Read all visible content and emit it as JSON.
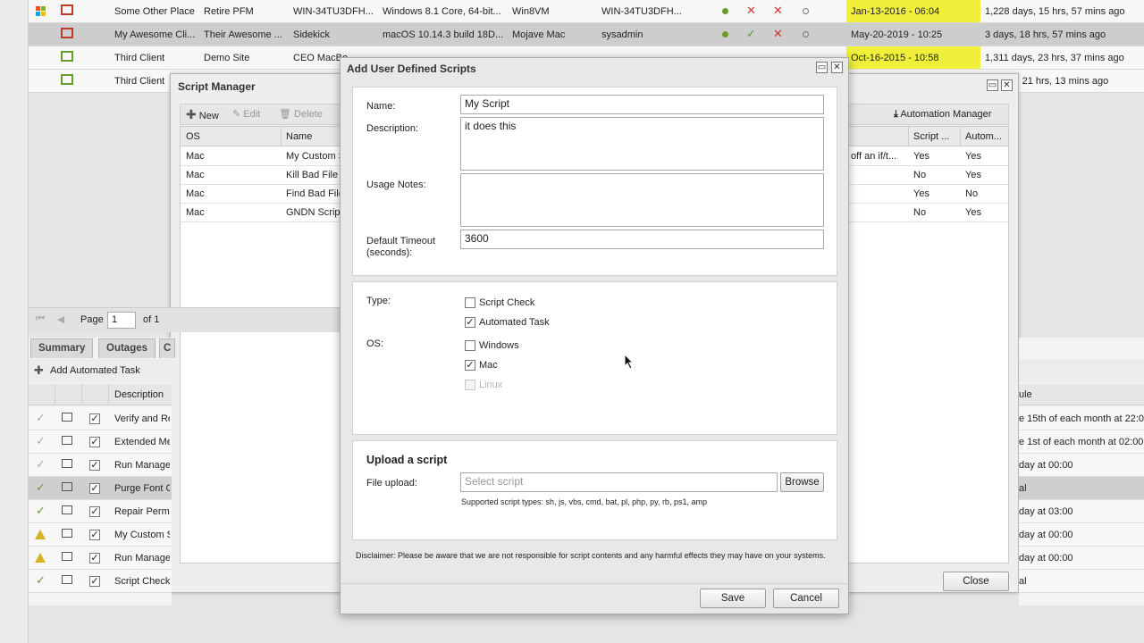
{
  "device_grid": {
    "rows": [
      {
        "os_icon": "windows-logo-icon",
        "client": "Some Other Place",
        "site": "Retire PFM",
        "name": "WIN-34TU3DFH...",
        "os": "Windows 8.1 Core, 64-bit...",
        "vm": "Win8VM",
        "user": "WIN-34TU3DFH...",
        "last_seen": "Jan-13-2016 - 06:04",
        "uptime": "1,228 days, 15 hrs, 57 mins ago",
        "highlight": true
      },
      {
        "os_icon": "apple-logo-icon",
        "client": "My Awesome Cli...",
        "site": "Their Awesome ...",
        "name": "Sidekick",
        "os": "macOS 10.14.3 build 18D...",
        "vm": "Mojave Mac",
        "user": "sysadmin",
        "last_seen": "May-20-2019 - 10:25",
        "uptime": "3 days, 18 hrs, 57 mins ago",
        "highlight": false
      },
      {
        "os_icon": "apple-logo-icon",
        "client": "Third Client",
        "site": "Demo Site",
        "name": "CEO MacBo",
        "os": "",
        "vm": "",
        "user": "",
        "last_seen": "Oct-16-2015 - 10:58",
        "uptime": "1,311 days, 23 hrs, 37 mins ago",
        "highlight": true
      },
      {
        "os_icon": "apple-logo-icon",
        "client": "Third Client",
        "site": "",
        "name": "",
        "os": "",
        "vm": "",
        "user": "",
        "last_seen": "",
        "uptime": "s, 21 hrs, 13 mins ago",
        "highlight": false
      }
    ]
  },
  "script_manager": {
    "title": "Script Manager",
    "toolbar": {
      "new": "New",
      "edit": "Edit",
      "delete": "Delete",
      "automation_manager": "Automation Manager"
    },
    "columns": {
      "os": "OS",
      "name": "Name",
      "script_check": "Script ...",
      "automated": "Autom..."
    },
    "rows": [
      {
        "os": "Mac",
        "name": "My Custom S",
        "desc": "off an if/t...",
        "script_check": "Yes",
        "automated": "Yes"
      },
      {
        "os": "Mac",
        "name": "Kill Bad File",
        "desc": "",
        "script_check": "No",
        "automated": "Yes"
      },
      {
        "os": "Mac",
        "name": "Find Bad File",
        "desc": "",
        "script_check": "Yes",
        "automated": "No"
      },
      {
        "os": "Mac",
        "name": "GNDN Script",
        "desc": "",
        "script_check": "No",
        "automated": "Yes"
      }
    ],
    "pager": {
      "page_label": "Page",
      "page_value": "1",
      "of_label": "of 1"
    },
    "close": "Close"
  },
  "bottom_panel": {
    "tabs": [
      "Summary",
      "Outages",
      "C"
    ],
    "add_task": "Add Automated Task",
    "add_task_more": "Aut",
    "columns": {
      "description": "Description",
      "schedule": "ule"
    },
    "rows": [
      {
        "status": "done",
        "description": "Verify and Re",
        "schedule": "e 15th of each month at 22:0"
      },
      {
        "status": "done",
        "description": "Extended Me",
        "schedule": "e 1st of each month at 02:00"
      },
      {
        "status": "done",
        "description": "Run Manage",
        "schedule": "day at 00:00"
      },
      {
        "status": "ok",
        "description": "Purge Font C",
        "schedule": "al"
      },
      {
        "status": "ok",
        "description": "Repair Permi",
        "schedule": "day at 03:00"
      },
      {
        "status": "warn",
        "description": "My Custom S",
        "schedule": "day at 00:00"
      },
      {
        "status": "warn",
        "description": "Run Manage",
        "schedule": "day at 00:00"
      },
      {
        "status": "ok",
        "description": "Script Check",
        "schedule": "al"
      }
    ]
  },
  "dialog": {
    "title": "Add User Defined Scripts",
    "name_label": "Name:",
    "name_value": "My Script",
    "description_label": "Description:",
    "description_value": "it does this",
    "usage_label": "Usage Notes:",
    "timeout_label_1": "Default Timeout",
    "timeout_label_2": "(seconds):",
    "timeout_value": "3600",
    "type_label": "Type:",
    "type_options": [
      {
        "label": "Script Check",
        "checked": false
      },
      {
        "label": "Automated Task",
        "checked": true
      }
    ],
    "os_label": "OS:",
    "os_options": [
      {
        "label": "Windows",
        "checked": false,
        "disabled": false
      },
      {
        "label": "Mac",
        "checked": true,
        "disabled": false
      },
      {
        "label": "Linux",
        "checked": false,
        "disabled": true
      }
    ],
    "upload_heading": "Upload a script",
    "file_upload_label": "File upload:",
    "file_placeholder": "Select script",
    "browse": "Browse",
    "supported_types": "Supported script types: sh, js, vbs, cmd, bat, pl, php, py, rb, ps1, amp",
    "disclaimer": "Disclaimer: Please be aware that we are not responsible for script contents and any harmful effects they may have on your systems.",
    "save": "Save",
    "cancel": "Cancel"
  }
}
